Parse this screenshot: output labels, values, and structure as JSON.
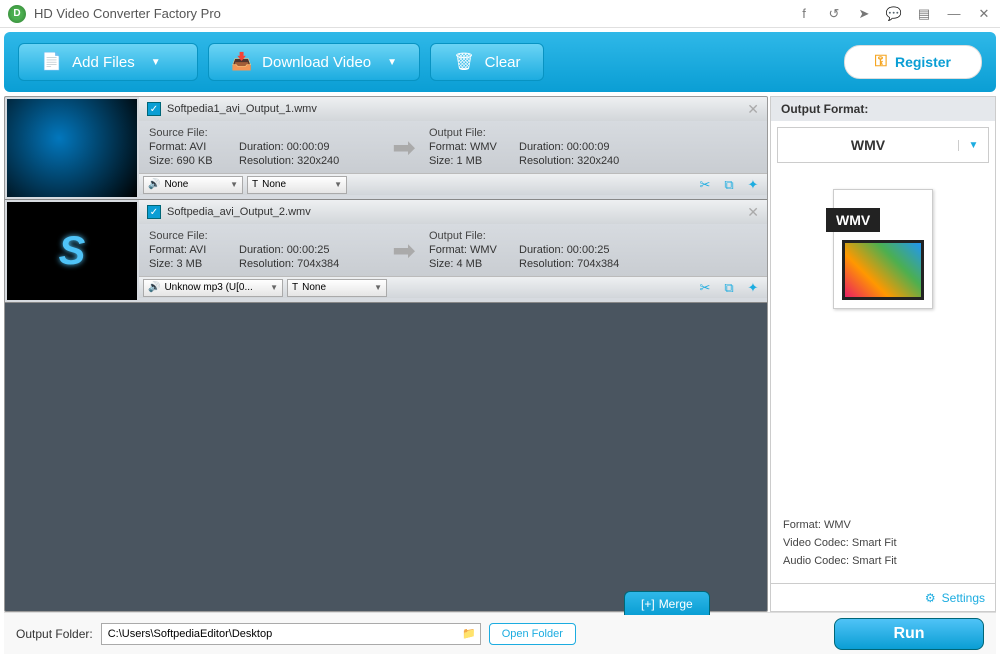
{
  "titlebar": {
    "title": "HD Video Converter Factory Pro"
  },
  "toolbar": {
    "add_files": "Add Files",
    "download_video": "Download Video",
    "clear": "Clear",
    "register": "Register"
  },
  "items": [
    {
      "name": "Softpedia1_avi_Output_1.wmv",
      "source_label": "Source File:",
      "output_label": "Output File:",
      "src_format": "Format: AVI",
      "src_duration": "Duration: 00:00:09",
      "src_size": "Size: 690 KB",
      "src_res": "Resolution: 320x240",
      "out_format": "Format: WMV",
      "out_duration": "Duration: 00:00:09",
      "out_size": "Size: 1 MB",
      "out_res": "Resolution: 320x240",
      "audio": "None",
      "subtitle": "None"
    },
    {
      "name": "Softpedia_avi_Output_2.wmv",
      "source_label": "Source File:",
      "output_label": "Output File:",
      "src_format": "Format: AVI",
      "src_duration": "Duration: 00:00:25",
      "src_size": "Size: 3 MB",
      "src_res": "Resolution: 704x384",
      "out_format": "Format: WMV",
      "out_duration": "Duration: 00:00:25",
      "out_size": "Size: 4 MB",
      "out_res": "Resolution: 704x384",
      "audio": "Unknow mp3 (U[0...",
      "subtitle": "None"
    }
  ],
  "sidebar": {
    "head": "Output Format:",
    "format": "WMV",
    "badge": "WMV",
    "meta_format": "Format: WMV",
    "meta_vcodec": "Video Codec: Smart Fit",
    "meta_acodec": "Audio Codec: Smart Fit",
    "settings": "Settings"
  },
  "bottom": {
    "merge": "Merge",
    "folder_label": "Output Folder:",
    "path": "C:\\Users\\SoftpediaEditor\\Desktop",
    "open_folder": "Open Folder",
    "run": "Run"
  }
}
